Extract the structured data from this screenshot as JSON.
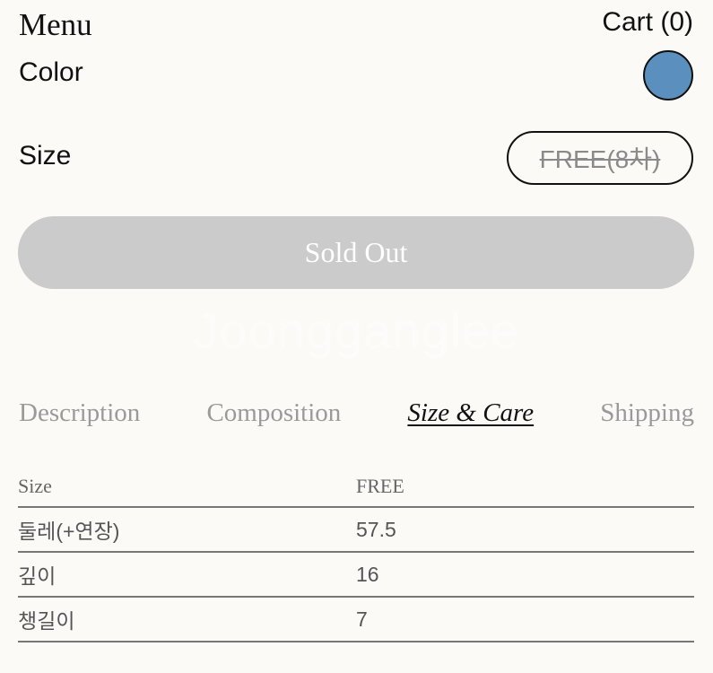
{
  "header": {
    "menu_label": "Menu",
    "cart_label": "Cart (0)"
  },
  "color": {
    "label": "Color",
    "swatch_color": "#5b8fbd"
  },
  "size": {
    "label": "Size",
    "option": "FREE(8차)"
  },
  "buy_button": {
    "label": "Sold Out"
  },
  "brand_watermark": "Joongganglee",
  "tabs": [
    {
      "label": "Description"
    },
    {
      "label": "Composition"
    },
    {
      "label": "Size & Care"
    },
    {
      "label": "Shipping"
    }
  ],
  "size_table": {
    "headers": [
      "Size",
      "FREE"
    ],
    "rows": [
      [
        "둘레(+연장)",
        "57.5"
      ],
      [
        "깊이",
        "16"
      ],
      [
        "챙길이",
        "7"
      ]
    ]
  }
}
